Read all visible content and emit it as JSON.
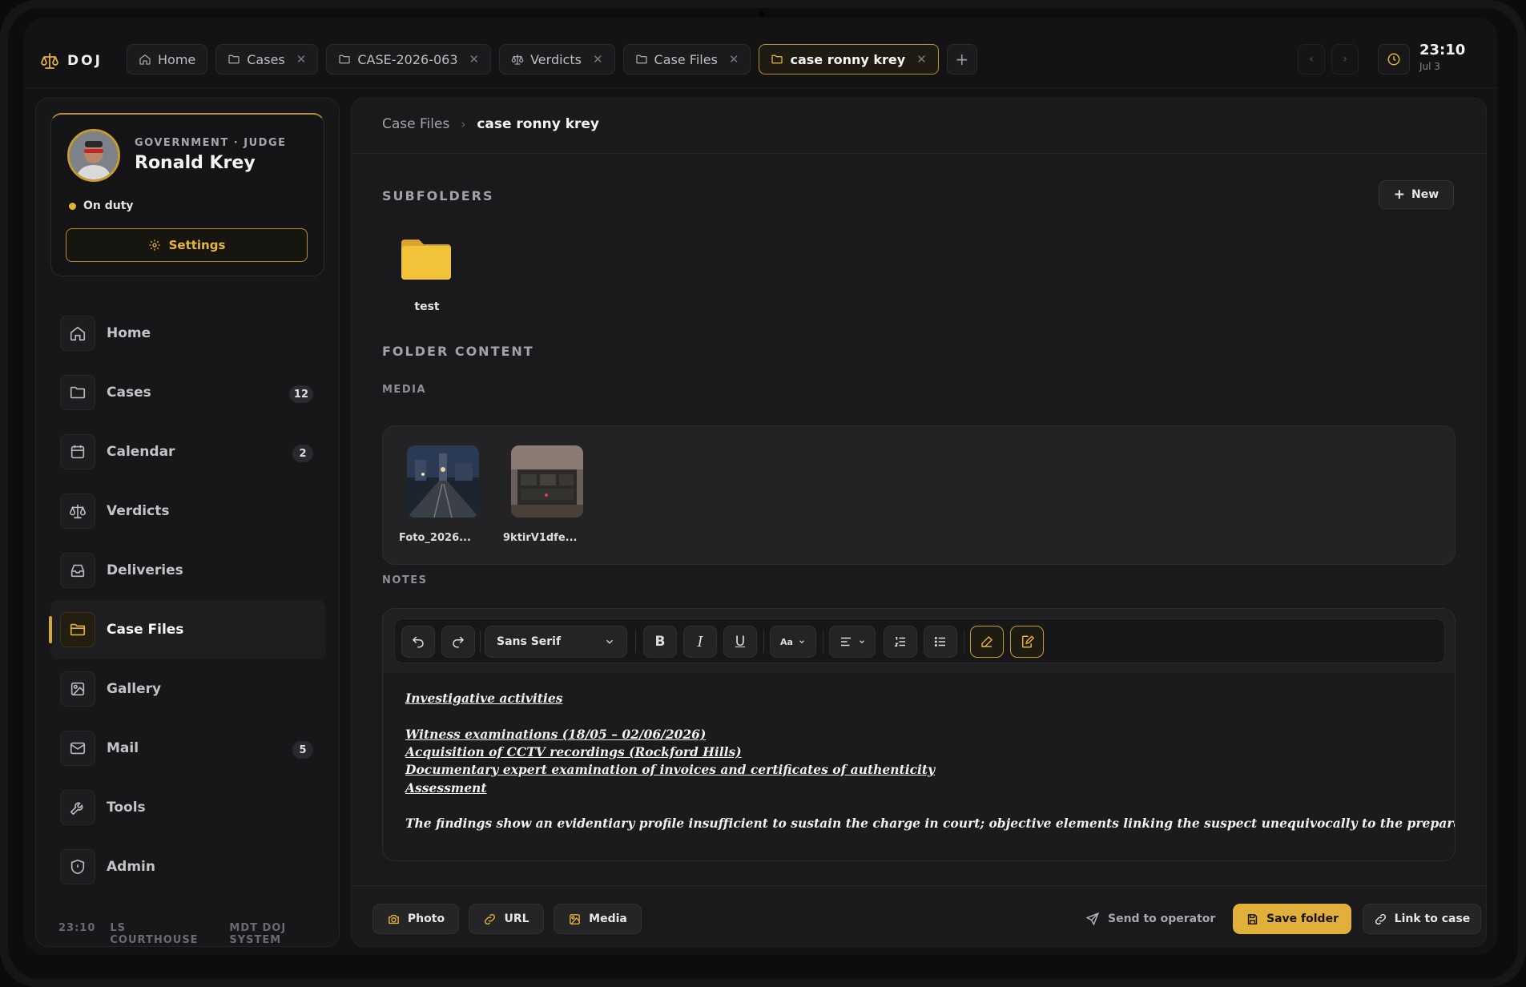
{
  "app": {
    "logo_text": "DOJ",
    "colors": {
      "accent": "#e0b03a",
      "background": "#131315",
      "panel": "#1a1a1c"
    }
  },
  "tabs": [
    {
      "label": "Home",
      "icon": "home-icon",
      "closable": false
    },
    {
      "label": "Cases",
      "icon": "folder-icon",
      "closable": true
    },
    {
      "label": "CASE-2026-063",
      "icon": "folder-icon",
      "closable": true
    },
    {
      "label": "Verdicts",
      "icon": "scales-icon",
      "closable": true
    },
    {
      "label": "Case Files",
      "icon": "folder-icon",
      "closable": true
    },
    {
      "label": "case ronny krey",
      "icon": "folder-icon",
      "closable": true,
      "active": true
    }
  ],
  "clock": {
    "time": "23:10",
    "date": "Jul 3"
  },
  "profile": {
    "role": "GOVERNMENT · JUDGE",
    "name": "Ronald Krey",
    "status": "On duty",
    "settings_label": "Settings"
  },
  "nav": [
    {
      "label": "Home",
      "icon": "home-icon"
    },
    {
      "label": "Cases",
      "icon": "folder-icon",
      "badge": "12"
    },
    {
      "label": "Calendar",
      "icon": "calendar-icon",
      "badge": "2"
    },
    {
      "label": "Verdicts",
      "icon": "scales-icon"
    },
    {
      "label": "Deliveries",
      "icon": "inbox-icon"
    },
    {
      "label": "Case Files",
      "icon": "folder-icon",
      "active": true
    },
    {
      "label": "Gallery",
      "icon": "image-icon"
    },
    {
      "label": "Mail",
      "icon": "mail-icon",
      "badge": "5"
    },
    {
      "label": "Tools",
      "icon": "wrench-icon"
    },
    {
      "label": "Admin",
      "icon": "shield-icon"
    }
  ],
  "footer": {
    "time": "23:10",
    "location": "LS COURTHOUSE",
    "system": "MDT DOJ SYSTEM"
  },
  "breadcrumb": {
    "parent": "Case Files",
    "separator": "›",
    "current": "case ronny krey"
  },
  "subfolders": {
    "title": "SUBFOLDERS",
    "new_label": "New",
    "items": [
      {
        "name": "test"
      }
    ]
  },
  "content": {
    "title": "FOLDER CONTENT",
    "media_title": "MEDIA",
    "media": [
      {
        "name": "Foto_2026..."
      },
      {
        "name": "9ktirV1dfe..."
      }
    ],
    "notes_title": "NOTES"
  },
  "editor": {
    "font_family": "Sans Serif",
    "size_label": "Aa",
    "lines": [
      "Investigative activities",
      "",
      "Witness examinations (18/05 – 02/06/2026)",
      "Acquisition of CCTV recordings (Rockford Hills)",
      "Documentary expert examination of invoices and certificates of authenticity",
      "Assessment"
    ],
    "paragraph": "The findings show an evidentiary profile insufficient to sustain the charge in court; objective elements linking the suspect unequivocally to the preparation of the"
  },
  "actions": {
    "photo": "Photo",
    "url": "URL",
    "media": "Media",
    "send": "Send to operator",
    "save": "Save folder",
    "link": "Link to case"
  }
}
